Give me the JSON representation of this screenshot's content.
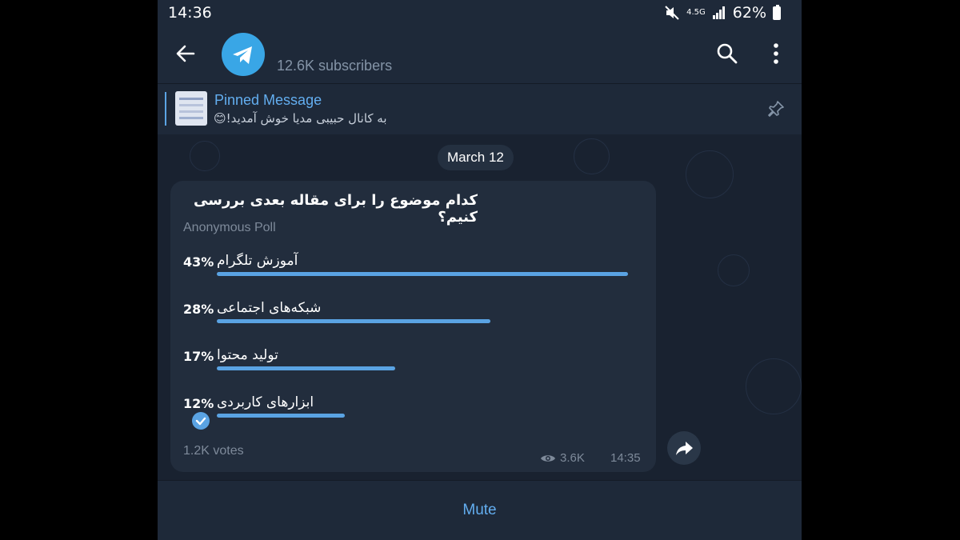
{
  "status_bar": {
    "time": "14:36",
    "network": "4.5G",
    "battery": "62%"
  },
  "header": {
    "subscribers": "12.6K subscribers",
    "icons": [
      "back-arrow-icon",
      "telegram-avatar-icon",
      "search-icon",
      "more-vertical-icon"
    ]
  },
  "pinned": {
    "title": "Pinned Message",
    "text": "به کانال حبیبی مدیا خوش آمدید!😊"
  },
  "chat": {
    "date": "March 12",
    "poll": {
      "question": "کدام موضوع را برای مقاله بعدی بررسی کنیم؟",
      "type": "Anonymous Poll",
      "options": [
        {
          "percent": "43%",
          "label": "آموزش تلگرام",
          "fill": 1.0
        },
        {
          "percent": "28%",
          "label": "شبکه‌های اجتماعی",
          "fill": 0.665
        },
        {
          "percent": "17%",
          "label": "تولید محتوا",
          "fill": 0.433
        },
        {
          "percent": "12%",
          "label": "ابزارهای کاربردی",
          "fill": 0.311,
          "selected": true
        }
      ],
      "votes": "1.2K votes",
      "views": "3.6K",
      "time": "14:35"
    }
  },
  "bottom": {
    "mute_label": "Mute"
  },
  "colors": {
    "accent": "#5aa3e3",
    "link": "#63aef0",
    "bubble": "#222d3d",
    "background": "#192230"
  }
}
